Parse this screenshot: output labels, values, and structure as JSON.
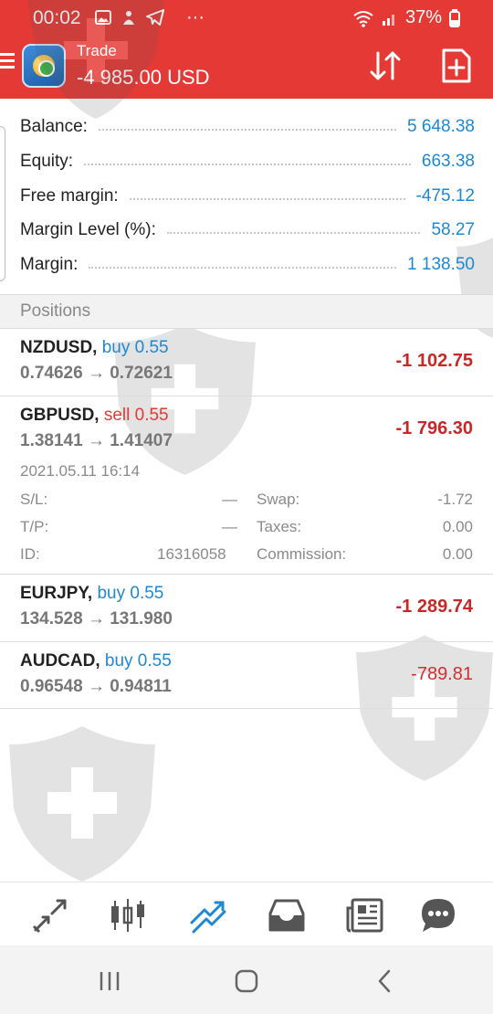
{
  "status_bar": {
    "time": "00:02",
    "battery": "37%",
    "icons": [
      "image-icon",
      "notification-icon",
      "telegram-icon",
      "more-dots-icon",
      "wifi-icon",
      "signal-icon",
      "battery-icon"
    ],
    "more": "···"
  },
  "app_bar": {
    "title": "Trade",
    "subtitle": "-4 985.00 USD"
  },
  "summary": [
    {
      "label": "Balance:",
      "value": "5 648.38"
    },
    {
      "label": "Equity:",
      "value": "663.38"
    },
    {
      "label": "Free margin:",
      "value": "-475.12"
    },
    {
      "label": "Margin Level (%):",
      "value": "58.27"
    },
    {
      "label": "Margin:",
      "value": "1 138.50"
    }
  ],
  "positions_header": "Positions",
  "positions": [
    {
      "symbol": "NZDUSD,",
      "side": "buy 0.55",
      "prices": "0.74626 → 0.72621",
      "profit": "-1 102.75"
    },
    {
      "symbol": "GBPUSD,",
      "side": "sell 0.55",
      "prices": "1.38141 → 1.41407",
      "profit": "-1 796.30",
      "details": {
        "datetime": "2021.05.11 16:14",
        "sl_label": "S/L:",
        "sl_value": "—",
        "tp_label": "T/P:",
        "tp_value": "—",
        "id_label": "ID:",
        "id_value": "16316058",
        "swap_label": "Swap:",
        "swap_value": "-1.72",
        "taxes_label": "Taxes:",
        "taxes_value": "0.00",
        "commission_label": "Commission:",
        "commission_value": "0.00"
      }
    },
    {
      "symbol": "EURJPY,",
      "side": "buy 0.55",
      "prices": "134.528 → 131.980",
      "profit": "-1 289.74"
    },
    {
      "symbol": "AUDCAD,",
      "side": "buy 0.55",
      "prices": "0.96548 → 0.94811",
      "profit": "-789.81"
    }
  ],
  "bottom_nav": [
    "quotes-icon",
    "chart-candles-icon",
    "trade-icon",
    "history-inbox-icon",
    "news-icon",
    "chat-icon"
  ],
  "colors": {
    "header": "#e53935",
    "value_blue": "#1e88d2",
    "loss_red": "#c62828",
    "active_nav": "#1e88d2"
  }
}
